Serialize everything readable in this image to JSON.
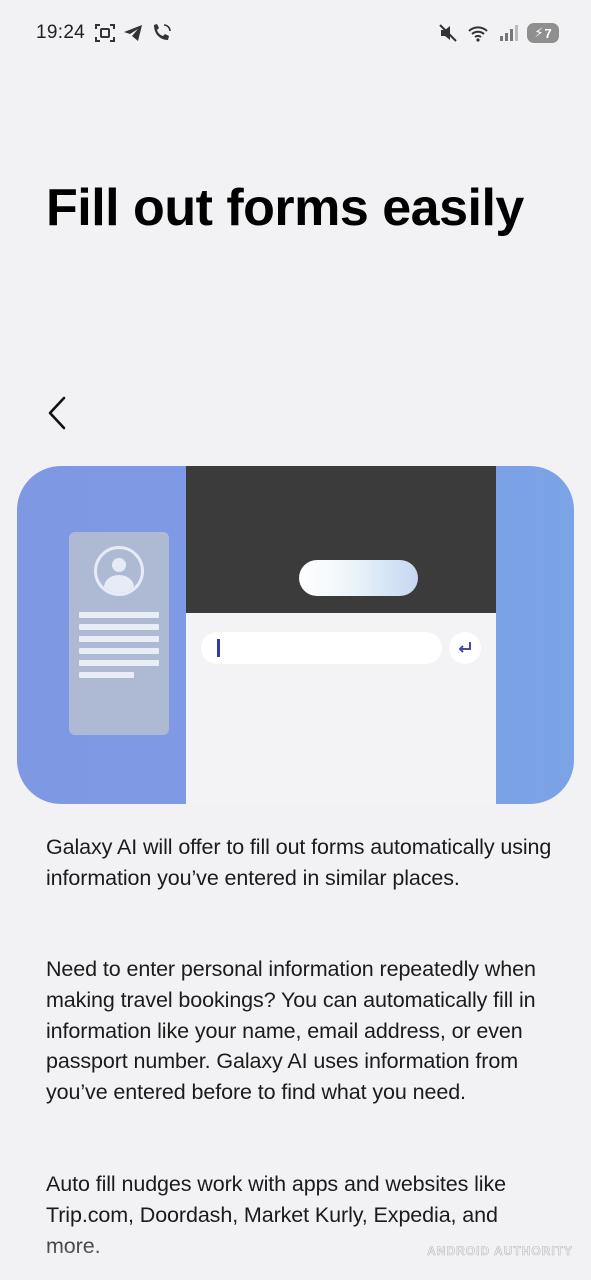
{
  "status_bar": {
    "time": "19:24",
    "left_icons": [
      "screenshot-icon",
      "telegram-icon",
      "wifi-calling-icon"
    ],
    "right_icons": [
      "mute-icon",
      "wifi-icon",
      "signal-icon",
      "battery-icon"
    ],
    "battery_level": "7"
  },
  "page": {
    "title": "Fill out forms easily",
    "back_icon": "chevron-left-icon"
  },
  "illustration": {
    "accent_color": "#7f98e3",
    "icons": [
      "avatar-icon",
      "enter-key-icon"
    ]
  },
  "body": {
    "paragraph_1": "Galaxy AI will offer to fill out forms automatically using information you’ve entered in similar places.",
    "paragraph_2": "Need to enter personal information repeatedly when making travel bookings? You can automatically fill in information like your name, email address, or even passport number. Galaxy AI uses information from you’ve entered before to find what you need.",
    "paragraph_3": "Auto fill nudges work with apps and websites like Trip.com, Doordash, Market Kurly, Expedia, and more."
  },
  "watermark": "ANDROID AUTHORITY"
}
